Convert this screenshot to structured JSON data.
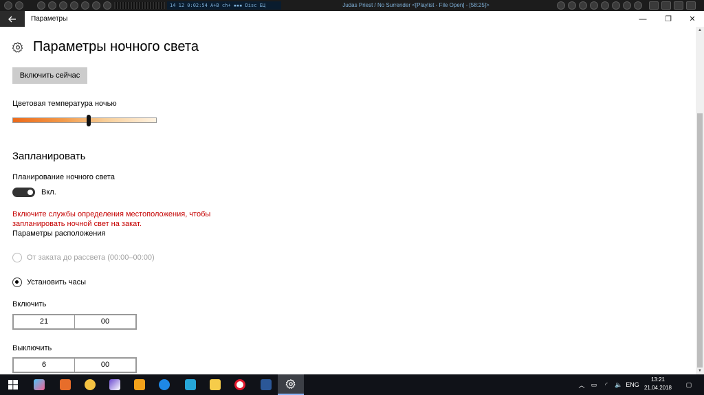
{
  "media_player": {
    "lcd_text": "14   12   0:02:54   A+B ch+   ▪▪▪   Disc   ЕЦ",
    "track_text": "Judas Priest / No Surrender   <[Playlist - File Open] - [58:25]>"
  },
  "window": {
    "title": "Параметры",
    "back_icon": "back-arrow-icon",
    "minimize": "—",
    "restore": "❐",
    "close": "✕"
  },
  "page": {
    "title": "Параметры ночного света",
    "enable_now_button": "Включить сейчас",
    "color_temp_label": "Цветовая температура ночью",
    "color_temp_value": 0.53,
    "schedule_heading": "Запланировать",
    "schedule_label": "Планирование ночного света",
    "schedule_toggle_state": "Вкл.",
    "schedule_toggle_on": true,
    "location_error": "Включите службы определения местоположения, чтобы запланировать ночной свет на закат.",
    "location_settings_link": "Параметры расположения",
    "radio_sunset": "От заката до рассвета (00:00–00:00)",
    "radio_set_hours": "Установить часы",
    "turn_on_label": "Включить",
    "turn_on_hour": "21",
    "turn_on_minute": "00",
    "turn_off_label": "Выключить",
    "turn_off_hour": "6",
    "turn_off_minute": "00"
  },
  "taskbar": {
    "apps": [
      "start",
      "paint-brush",
      "fl-studio",
      "winamp",
      "vlc",
      "lightning",
      "ccleaner",
      "remote",
      "folder",
      "opera",
      "word",
      "settings"
    ],
    "language": "ENG",
    "time": "13:21",
    "date": "21.04.2018"
  },
  "colors": {
    "error": "#c50000",
    "toggle_on": "#333333",
    "taskbar": "#101218"
  }
}
